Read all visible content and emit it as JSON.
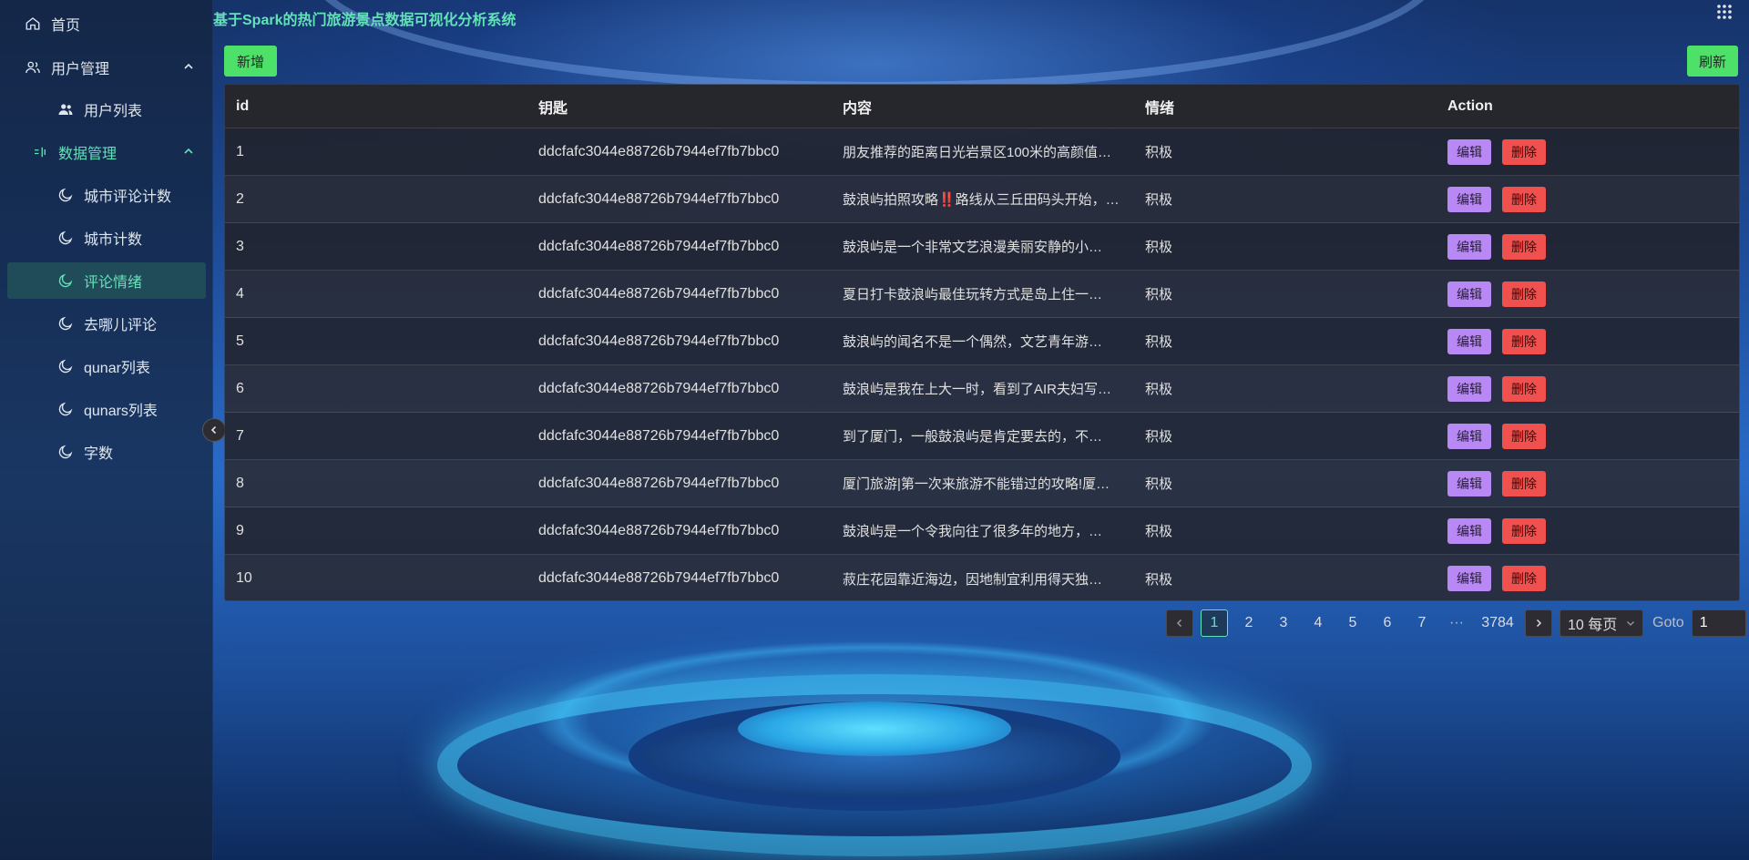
{
  "app_title": "基于Spark的热门旅游景点数据可视化分析系统",
  "sidebar": {
    "items": [
      {
        "label": "首页",
        "icon": "home-icon"
      },
      {
        "label": "用户管理",
        "icon": "users-icon"
      },
      {
        "label": "用户列表",
        "icon": "user-group-icon"
      },
      {
        "label": "数据管理",
        "icon": "data-icon"
      },
      {
        "label": "城市评论计数",
        "icon": "moon-icon"
      },
      {
        "label": "城市计数",
        "icon": "moon-icon"
      },
      {
        "label": "评论情绪",
        "icon": "moon-icon"
      },
      {
        "label": "去哪儿评论",
        "icon": "moon-icon"
      },
      {
        "label": "qunar列表",
        "icon": "moon-icon"
      },
      {
        "label": "qunars列表",
        "icon": "moon-icon"
      },
      {
        "label": "字数",
        "icon": "moon-icon"
      }
    ]
  },
  "toolbar": {
    "add_label": "新增",
    "refresh_label": "刷新"
  },
  "table": {
    "columns": [
      "id",
      "钥匙",
      "内容",
      "情绪",
      "Action"
    ],
    "edit_label": "编辑",
    "delete_label": "删除",
    "rows": [
      {
        "id": "1",
        "key": "ddcfafc3044e88726b7944ef7fb7bbc0",
        "content": "朋友推荐的距离日光岩景区100米的高颜值…",
        "sentiment": "积极"
      },
      {
        "id": "2",
        "key": "ddcfafc3044e88726b7944ef7fb7bbc0",
        "content": "鼓浪屿拍照攻略‼️路线从三丘田码头开始，…",
        "sentiment": "积极"
      },
      {
        "id": "3",
        "key": "ddcfafc3044e88726b7944ef7fb7bbc0",
        "content": "鼓浪屿是一个非常文艺浪漫美丽安静的小…",
        "sentiment": "积极"
      },
      {
        "id": "4",
        "key": "ddcfafc3044e88726b7944ef7fb7bbc0",
        "content": "夏日打卡鼓浪屿最佳玩转方式是岛上住一…",
        "sentiment": "积极"
      },
      {
        "id": "5",
        "key": "ddcfafc3044e88726b7944ef7fb7bbc0",
        "content": "鼓浪屿的闻名不是一个偶然，文艺青年游…",
        "sentiment": "积极"
      },
      {
        "id": "6",
        "key": "ddcfafc3044e88726b7944ef7fb7bbc0",
        "content": "鼓浪屿是我在上大一时，看到了AIR夫妇写…",
        "sentiment": "积极"
      },
      {
        "id": "7",
        "key": "ddcfafc3044e88726b7944ef7fb7bbc0",
        "content": "到了厦门，一般鼓浪屿是肯定要去的，不…",
        "sentiment": "积极"
      },
      {
        "id": "8",
        "key": "ddcfafc3044e88726b7944ef7fb7bbc0",
        "content": "厦门旅游|第一次来旅游不能错过的攻略!厦…",
        "sentiment": "积极"
      },
      {
        "id": "9",
        "key": "ddcfafc3044e88726b7944ef7fb7bbc0",
        "content": "鼓浪屿是一个令我向往了很多年的地方，…",
        "sentiment": "积极"
      },
      {
        "id": "10",
        "key": "ddcfafc3044e88726b7944ef7fb7bbc0",
        "content": "菽庄花园靠近海边，因地制宜利用得天独…",
        "sentiment": "积极"
      }
    ]
  },
  "pagination": {
    "pages": [
      "1",
      "2",
      "3",
      "4",
      "5",
      "6",
      "7"
    ],
    "ellipsis": "···",
    "last_page": "3784",
    "page_size_label": "10 每页",
    "goto_label": "Goto",
    "goto_value": "1"
  },
  "colors": {
    "accent": "#63e2b7",
    "add_button": "#4ee16a",
    "edit_button": "#b889f4",
    "delete_button": "#f0504e"
  }
}
